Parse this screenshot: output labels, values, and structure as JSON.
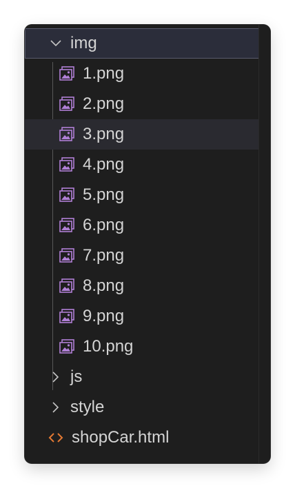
{
  "explorer": {
    "folder_img": {
      "label": "img",
      "expanded": true
    },
    "img_files": [
      {
        "label": "1.png",
        "icon": "image-file-icon"
      },
      {
        "label": "2.png",
        "icon": "image-file-icon"
      },
      {
        "label": "3.png",
        "icon": "image-file-icon"
      },
      {
        "label": "4.png",
        "icon": "image-file-icon"
      },
      {
        "label": "5.png",
        "icon": "image-file-icon"
      },
      {
        "label": "6.png",
        "icon": "image-file-icon"
      },
      {
        "label": "7.png",
        "icon": "image-file-icon"
      },
      {
        "label": "8.png",
        "icon": "image-file-icon"
      },
      {
        "label": "9.png",
        "icon": "image-file-icon"
      },
      {
        "label": "10.png",
        "icon": "image-file-icon"
      }
    ],
    "folder_js": {
      "label": "js",
      "expanded": false
    },
    "folder_style": {
      "label": "style",
      "expanded": false
    },
    "file_html": {
      "label": "shopCar.html",
      "icon": "html-code-icon"
    }
  },
  "colors": {
    "background": "#1e1e1e",
    "text": "#d4d4d4",
    "image_icon": "#b180d7",
    "html_icon": "#e37933",
    "selection": "#2b2d3a",
    "hover": "#2a2a30"
  }
}
